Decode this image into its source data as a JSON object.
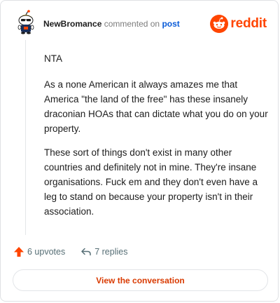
{
  "header": {
    "username": "NewBromance",
    "action_text": "commented on",
    "post_link": "post",
    "brand_name": "reddit"
  },
  "comment": {
    "paragraphs": [
      "NTA",
      "As a none American it always amazes me that America \"the land of the free\" has these insanely draconian HOAs that can dictate what you do on your property.",
      "These sort of things don't exist in many other countries and definitely not in mine. They're insane organisations. Fuck em and they don't even have a leg to stand on because your property isn't in their association."
    ]
  },
  "stats": {
    "upvotes_label": "6 upvotes",
    "replies_label": "7 replies"
  },
  "cta": {
    "label": "View the conversation"
  },
  "icons": {
    "avatar": "snoo-avatar-icon",
    "brand": "reddit-logo-icon",
    "upvote": "upvote-arrow-icon",
    "reply": "reply-arrow-icon"
  },
  "colors": {
    "brand_orange": "#ff4500",
    "link_blue": "#0a5bd8",
    "cta_text": "#d93a00",
    "muted_text": "#576f76"
  }
}
